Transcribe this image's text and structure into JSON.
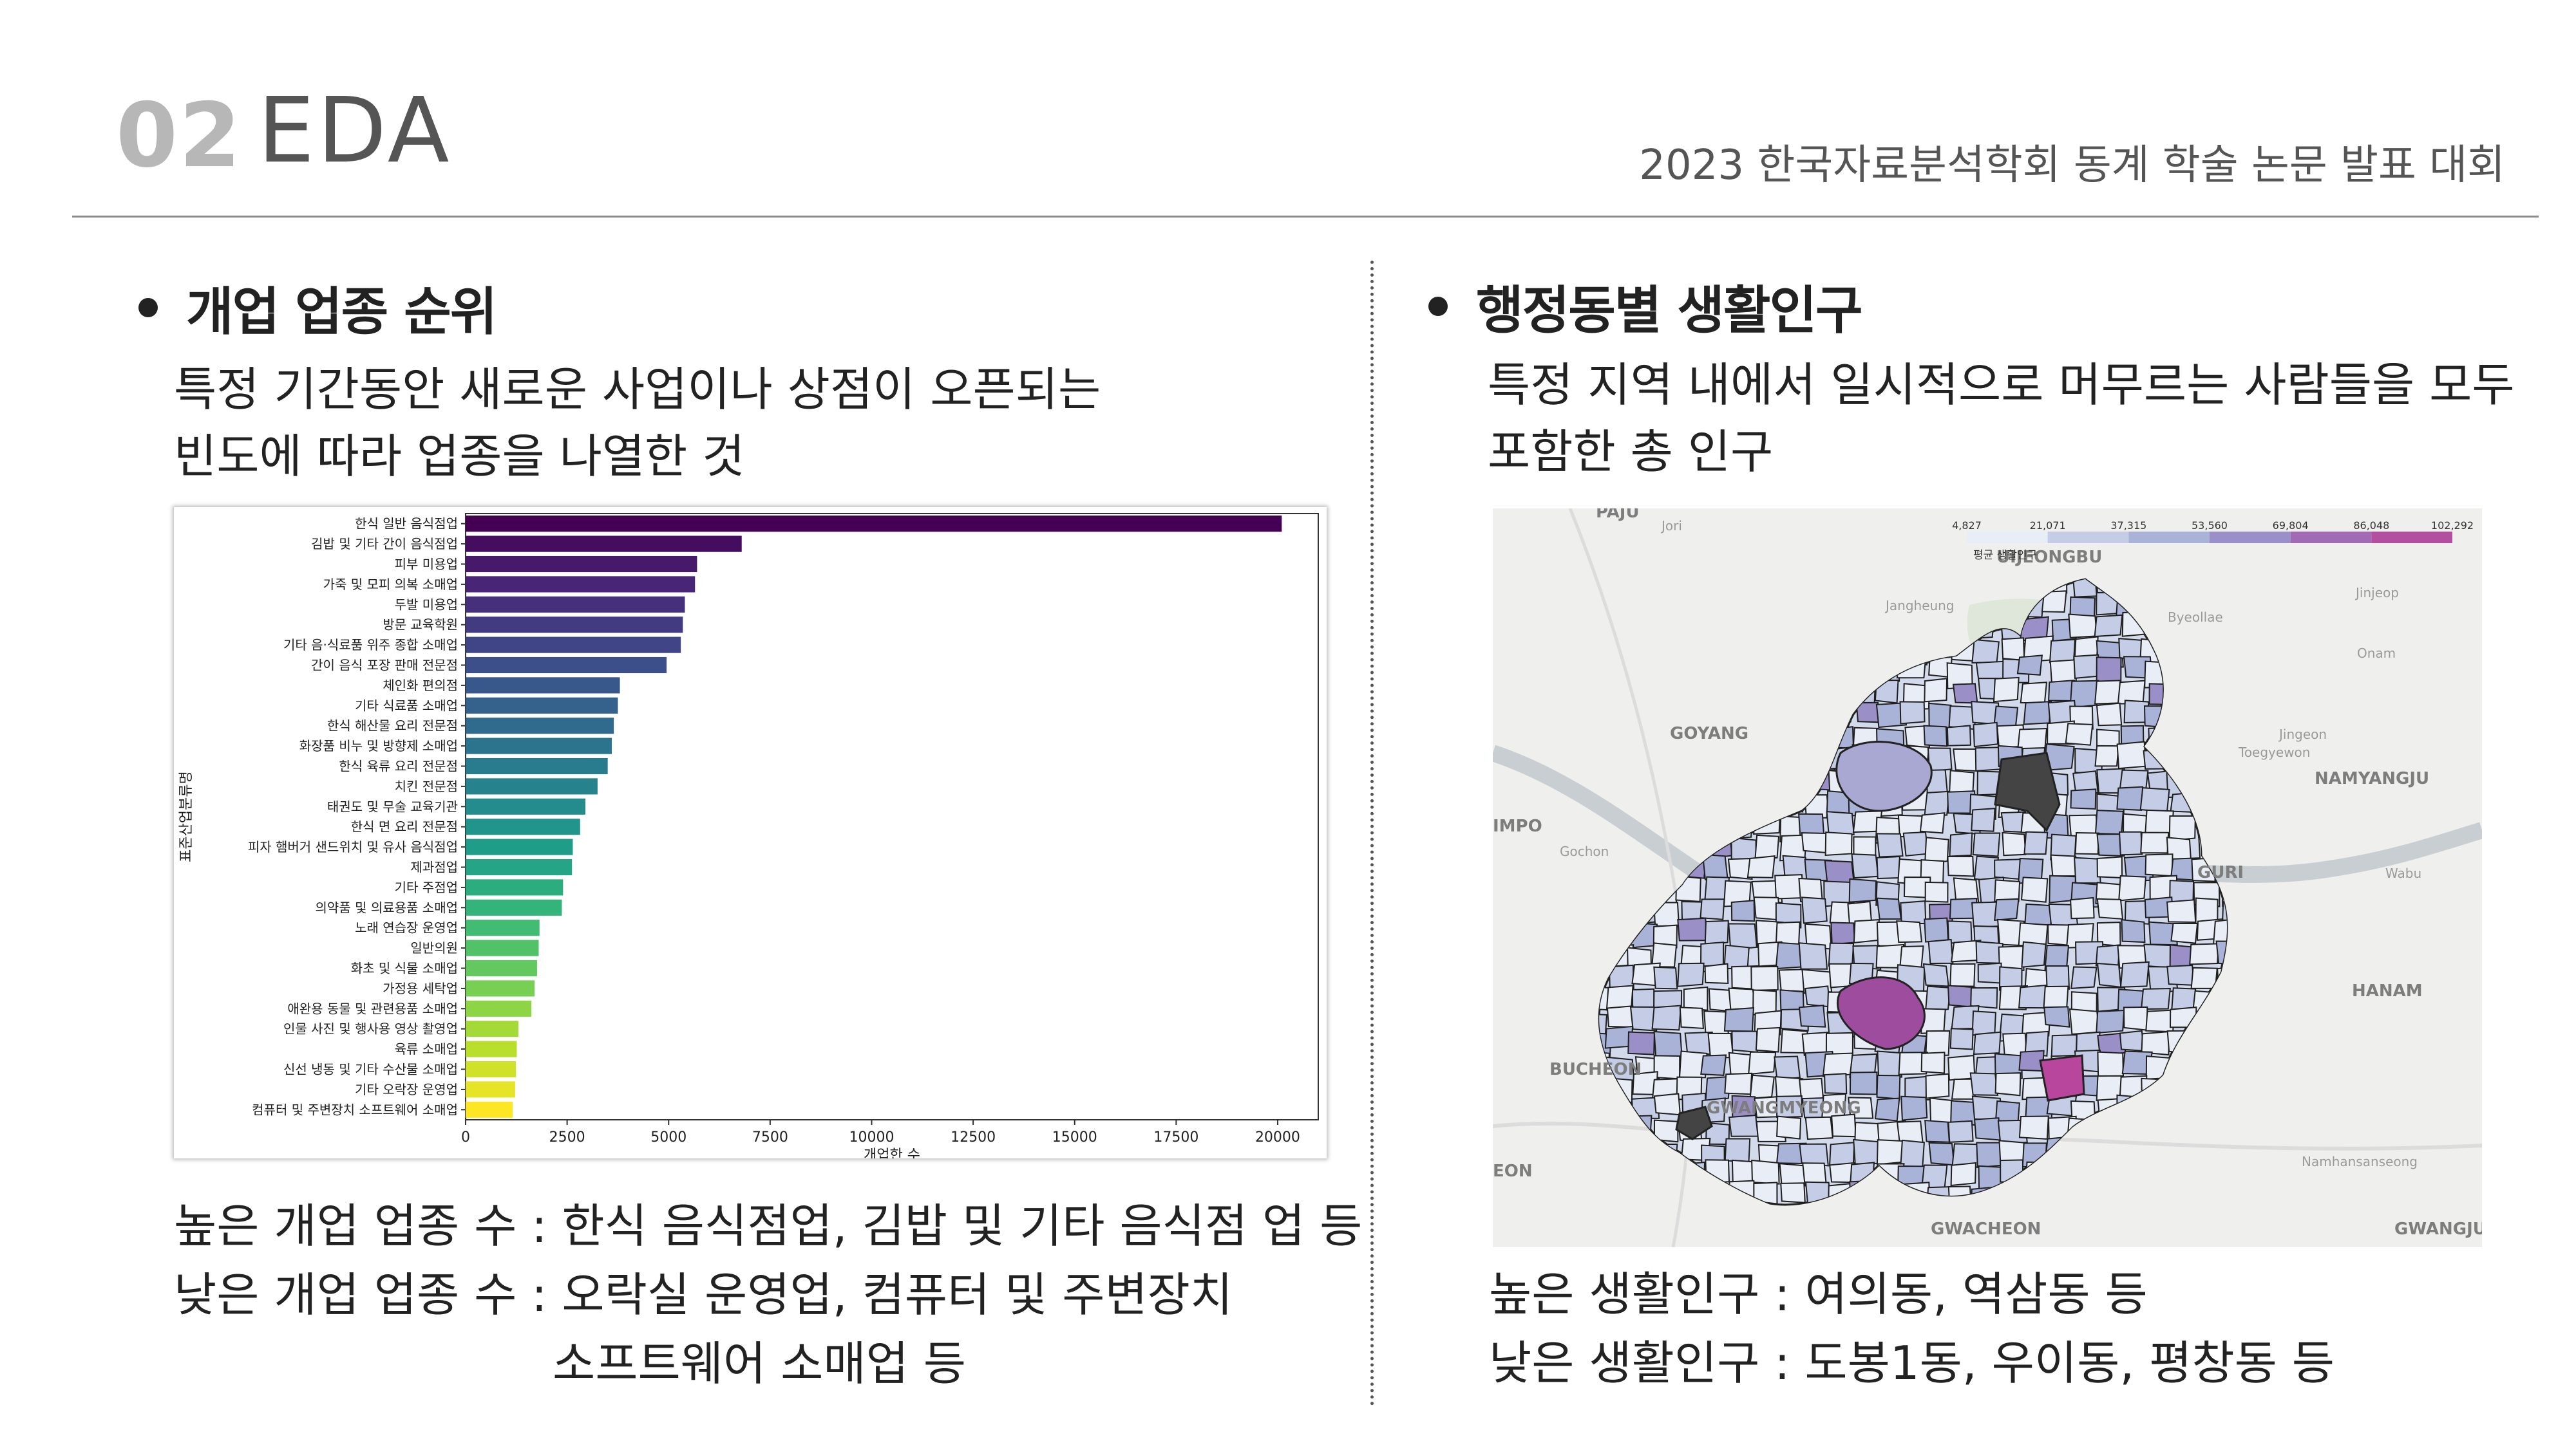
{
  "header": {
    "section_number": "02",
    "section_title": "EDA",
    "conference": "2023 한국자료분석학회 동계 학술 논문 발표 대회"
  },
  "left": {
    "bullet": "개업 업종 순위",
    "description": [
      "특정 기간동안 새로운 사업이나 상점이 오픈되는",
      "빈도에 따라 업종을 나열한 것"
    ],
    "summary_high": "높은 개업 업종 수 : 한식 음식점업, 김밥 및 기타 음식점 업 등",
    "summary_low_1": "낮은 개업 업종 수 : 오락실 운영업, 컴퓨터 및 주변장치",
    "summary_low_2": "소프트웨어 소매업 등"
  },
  "right": {
    "bullet": "행정동별 생활인구",
    "description": [
      "특정 지역 내에서 일시적으로 머무르는 사람들을 모두",
      "포함한 총 인구"
    ],
    "summary_high": "높은 생활인구 : 여의동, 역삼동 등",
    "summary_low": "낮은 생활인구 : 도봉1동, 우이동, 평창동 등"
  },
  "chart_data": {
    "type": "bar",
    "orientation": "horizontal",
    "title": "",
    "xlabel": "개업한 수",
    "ylabel": "표준산업분류명",
    "xlim": [
      0,
      21000
    ],
    "xticks": [
      0,
      2500,
      5000,
      7500,
      10000,
      12500,
      15000,
      17500,
      20000
    ],
    "colormap": "viridis",
    "categories": [
      "한식 일반 음식점업",
      "김밥 및 기타 간이 음식점업",
      "피부 미용업",
      "가죽 및 모피 의복 소매업",
      "두발 미용업",
      "방문 교육학원",
      "기타 음·식료품 위주 종합 소매업",
      "간이 음식 포장 판매 전문점",
      "체인화 편의점",
      "기타 식료품 소매업",
      "한식 해산물 요리 전문점",
      "화장품 비누 및 방향제 소매업",
      "한식 육류 요리 전문점",
      "치킨 전문점",
      "태권도 및 무술 교육기관",
      "한식 면 요리 전문점",
      "피자 햄버거 샌드위치 및 유사 음식점업",
      "제과점업",
      "기타 주점업",
      "의약품 및 의료용품 소매업",
      "노래 연습장 운영업",
      "일반의원",
      "화초 및 식물 소매업",
      "가정용 세탁업",
      "애완용 동물 및 관련용품 소매업",
      "인물 사진 및 행사용 영상 촬영업",
      "육류 소매업",
      "신선 냉동 및 기타 수산물 소매업",
      "기타 오락장 운영업",
      "컴퓨터 및 주변장치 소프트웨어 소매업"
    ],
    "values": [
      20100,
      6800,
      5700,
      5650,
      5400,
      5350,
      5300,
      4950,
      3800,
      3750,
      3650,
      3600,
      3500,
      3250,
      2950,
      2820,
      2640,
      2620,
      2400,
      2370,
      1820,
      1800,
      1760,
      1700,
      1620,
      1300,
      1260,
      1240,
      1220,
      1160
    ]
  },
  "map": {
    "legend_title": "평균 생활인구",
    "legend_ticks": [
      "4,827",
      "21,071",
      "37,315",
      "53,560",
      "69,804",
      "86,048",
      "102,292"
    ],
    "colors": [
      "#e8edf6",
      "#c4cde5",
      "#a9b3d8",
      "#9a8fc6",
      "#a06bb4",
      "#b34f9f"
    ],
    "place_labels": [
      "PAJU",
      "Jori",
      "UIJEONGBU",
      "Jinjeop",
      "Jangheung",
      "Byeollae",
      "Onam",
      "GOYANG",
      "Jingeon",
      "Toegyewon",
      "NAMYANGJU",
      "IMPO",
      "Gochon",
      "GURI",
      "Wabu",
      "HANAM",
      "BUCHEON",
      "GWANGMYEONG",
      "EON",
      "Namhansanseong",
      "GWACHEON",
      "GWANGJU"
    ]
  }
}
